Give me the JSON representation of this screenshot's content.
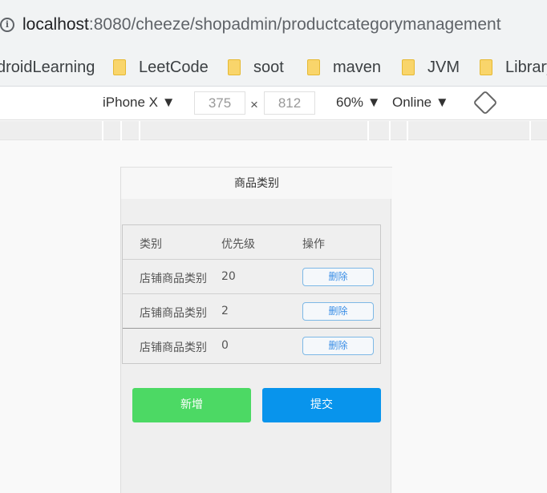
{
  "browser": {
    "url_host": "localhost",
    "url_rest": ":8080/cheeze/shopadmin/productcategorymanagement",
    "bookmarks": [
      {
        "label": "droidLearning",
        "icon": "folder-icon"
      },
      {
        "label": "LeetCode",
        "icon": "folder-icon"
      },
      {
        "label": "soot",
        "icon": "folder-icon"
      },
      {
        "label": "maven",
        "icon": "folder-icon"
      },
      {
        "label": "JVM",
        "icon": "folder-icon"
      },
      {
        "label": "Library",
        "icon": "folder-icon"
      }
    ]
  },
  "device_toolbar": {
    "device": "iPhone X",
    "width": "375",
    "height": "812",
    "zoom": "60%",
    "network": "Online"
  },
  "page": {
    "title": "商品类别",
    "table": {
      "headers": [
        "类别",
        "优先级",
        "操作"
      ],
      "rows": [
        {
          "name": "店铺商品类别",
          "priority": "20",
          "action": "删除"
        },
        {
          "name": "店铺商品类别",
          "priority": "2",
          "action": "删除"
        },
        {
          "name": "店铺商品类别",
          "priority": "0",
          "action": "删除"
        }
      ]
    },
    "add_label": "新增",
    "submit_label": "提交"
  },
  "colors": {
    "add_button": "#4cd964",
    "submit_button": "#0894ec",
    "delete_button_text": "#3a8ee6"
  }
}
